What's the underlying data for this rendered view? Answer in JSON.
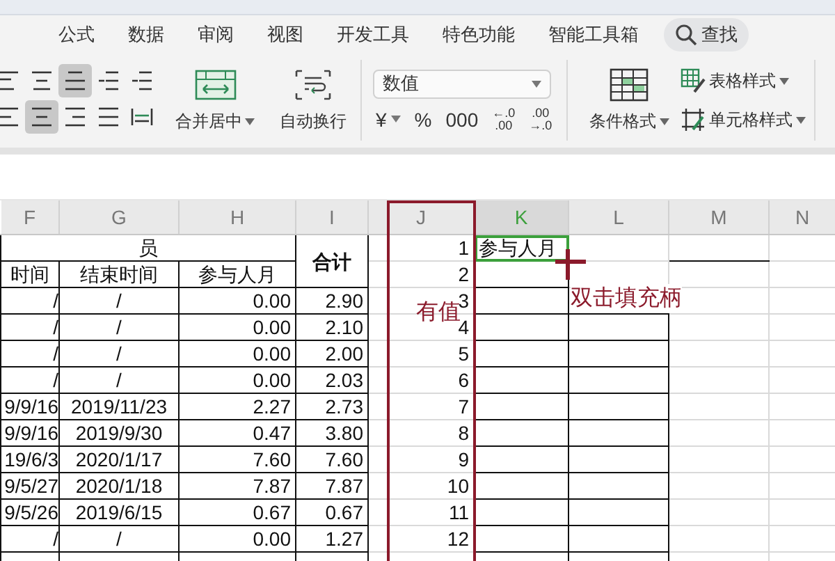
{
  "menu_tabs": [
    {
      "label": "公式"
    },
    {
      "label": "数据"
    },
    {
      "label": "审阅"
    },
    {
      "label": "视图"
    },
    {
      "label": "开发工具"
    },
    {
      "label": "特色功能"
    },
    {
      "label": "智能工具箱"
    }
  ],
  "search": {
    "label": "查找"
  },
  "ribbon": {
    "align_buttons": [
      {
        "selected": false
      },
      {
        "selected": false
      },
      {
        "selected": true
      },
      {
        "selected": false
      },
      {
        "selected": false
      },
      {
        "selected": false
      },
      {
        "selected": true
      },
      {
        "selected": false
      },
      {
        "selected": false
      },
      {
        "selected": false
      }
    ],
    "merge_button": {
      "label": "合并居中"
    },
    "wrap_button": {
      "label": "自动换行"
    },
    "number_format": {
      "value": "数值"
    },
    "number_buttons": [
      "¥",
      "%",
      "000"
    ],
    "decimal_buttons": [
      {
        "top": "←.0",
        "bottom": ".00"
      },
      {
        "top": ".00",
        "bottom": "→.0"
      }
    ],
    "conditional_button": {
      "label": "条件格式"
    },
    "table_style_button": {
      "label": "表格样式"
    },
    "cell_style_button": {
      "label": "单元格样式"
    }
  },
  "sheet": {
    "columns": [
      {
        "label": "F",
        "selected": false
      },
      {
        "label": "G",
        "selected": false
      },
      {
        "label": "H",
        "selected": false
      },
      {
        "label": "I",
        "selected": false
      },
      {
        "label": "J",
        "selected": false
      },
      {
        "label": "K",
        "selected": true
      },
      {
        "label": "L",
        "selected": false
      },
      {
        "label": "M",
        "selected": false
      },
      {
        "label": "N",
        "selected": false
      }
    ],
    "group_label": "员",
    "total_label": "合计",
    "subheaders": [
      "时间",
      "结束时间",
      "参与人月"
    ],
    "rows": [
      {
        "start": "/",
        "end": "/",
        "person_months": "0.00",
        "total": "2.90"
      },
      {
        "start": "/",
        "end": "/",
        "person_months": "0.00",
        "total": "2.10"
      },
      {
        "start": "/",
        "end": "/",
        "person_months": "0.00",
        "total": "2.00"
      },
      {
        "start": "/",
        "end": "/",
        "person_months": "0.00",
        "total": "2.03"
      },
      {
        "start": "9/9/16",
        "end": "2019/11/23",
        "person_months": "2.27",
        "total": "2.73"
      },
      {
        "start": "9/9/16",
        "end": "2019/9/30",
        "person_months": "0.47",
        "total": "3.80"
      },
      {
        "start": "19/6/3",
        "end": "2020/1/17",
        "person_months": "7.60",
        "total": "7.60"
      },
      {
        "start": "9/5/27",
        "end": "2020/1/18",
        "person_months": "7.87",
        "total": "7.87"
      },
      {
        "start": "9/5/26",
        "end": "2019/6/15",
        "person_months": "0.67",
        "total": "0.67"
      },
      {
        "start": "/",
        "end": "/",
        "person_months": "0.00",
        "total": "1.27"
      }
    ],
    "column_j_values": [
      "1",
      "2",
      "3",
      "4",
      "5",
      "6",
      "7",
      "8",
      "9",
      "10",
      "11",
      "12"
    ],
    "active_cell": {
      "value": "参与人月",
      "selected": true
    }
  },
  "annotations": {
    "column_note": "有值",
    "handle_note": "双击填充柄"
  }
}
